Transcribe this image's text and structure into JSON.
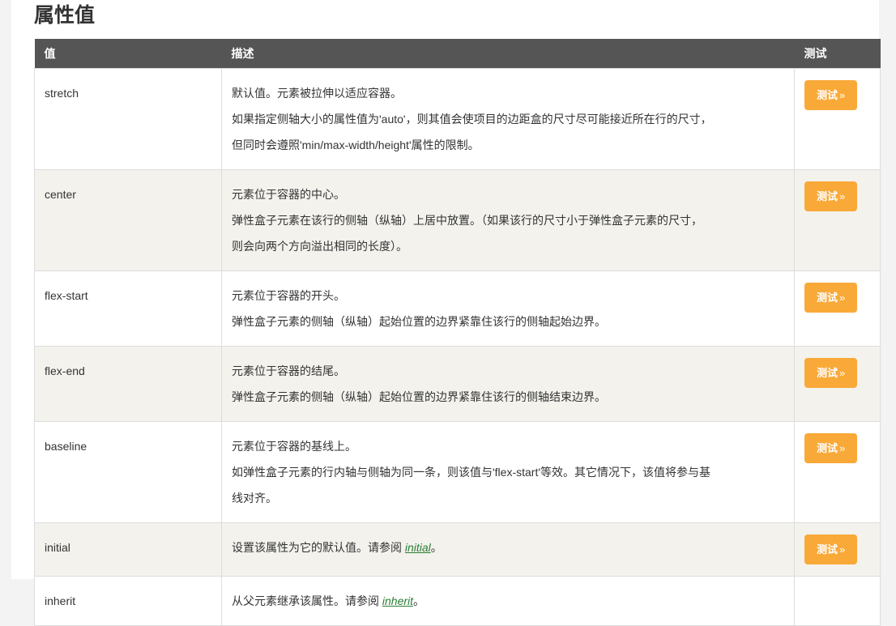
{
  "page": {
    "title": "属性值",
    "accent_color": "#f9a938",
    "header_bg": "#555555",
    "alt_row_bg": "#f3f2ed",
    "link_color": "#2a7d34"
  },
  "table": {
    "headers": {
      "value": "值",
      "description": "描述",
      "test": "测试"
    },
    "button_label": "测试",
    "button_chevron": "»",
    "rows": [
      {
        "value": "stretch",
        "lines": [
          "默认值。元素被拉伸以适应容器。",
          "如果指定侧轴大小的属性值为'auto'，则其值会使项目的边距盒的尺寸尽可能接近所在行的尺寸，",
          "但同时会遵照'min/max-width/height'属性的限制。"
        ],
        "has_test_button": true
      },
      {
        "value": "center",
        "lines": [
          "元素位于容器的中心。",
          "弹性盒子元素在该行的侧轴（纵轴）上居中放置。（如果该行的尺寸小于弹性盒子元素的尺寸，",
          "则会向两个方向溢出相同的长度）。"
        ],
        "has_test_button": true
      },
      {
        "value": "flex-start",
        "lines": [
          "元素位于容器的开头。",
          "弹性盒子元素的侧轴（纵轴）起始位置的边界紧靠住该行的侧轴起始边界。"
        ],
        "has_test_button": true
      },
      {
        "value": "flex-end",
        "lines": [
          "元素位于容器的结尾。",
          "弹性盒子元素的侧轴（纵轴）起始位置的边界紧靠住该行的侧轴结束边界。"
        ],
        "has_test_button": true
      },
      {
        "value": "baseline",
        "lines": [
          "元素位于容器的基线上。",
          "如弹性盒子元素的行内轴与侧轴为同一条，则该值与'flex-start'等效。其它情况下，该值将参与基",
          "线对齐。"
        ],
        "has_test_button": true
      },
      {
        "value": "initial",
        "prefix": "设置该属性为它的默认值。请参阅 ",
        "link": "initial",
        "suffix": "。",
        "has_test_button": true
      },
      {
        "value": "inherit",
        "prefix": "从父元素继承该属性。请参阅 ",
        "link": "inherit",
        "suffix": "。",
        "has_test_button": false
      }
    ]
  }
}
